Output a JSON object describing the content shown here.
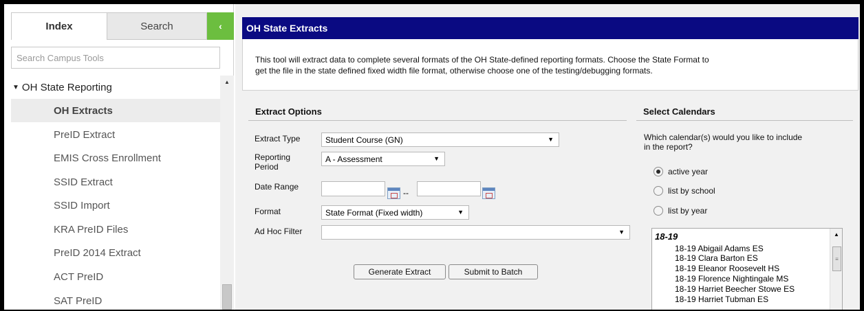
{
  "sidebar": {
    "tabs": {
      "index": "Index",
      "search": "Search"
    },
    "collapse_glyph": "‹",
    "search_placeholder": "Search Campus Tools",
    "group": {
      "label": "OH State Reporting",
      "caret": "▼"
    },
    "items": [
      {
        "label": "OH Extracts",
        "active": true
      },
      {
        "label": "PreID Extract"
      },
      {
        "label": "EMIS Cross Enrollment"
      },
      {
        "label": "SSID Extract"
      },
      {
        "label": "SSID Import"
      },
      {
        "label": "KRA PreID Files"
      },
      {
        "label": "PreID 2014 Extract"
      },
      {
        "label": "ACT PreID"
      },
      {
        "label": "SAT PreID"
      }
    ]
  },
  "main": {
    "title": "OH State Extracts",
    "description_line1": "This tool will extract data to complete several formats of the OH State-defined reporting formats. Choose the State Format to",
    "description_line2": "get the file in the state defined fixed width file format, otherwise choose one of the testing/debugging formats.",
    "extract_options": {
      "heading": "Extract Options",
      "extract_type_label": "Extract Type",
      "extract_type_value": "Student Course (GN)",
      "reporting_period_label_1": "Reporting",
      "reporting_period_label_2": "Period",
      "reporting_period_value": "A - Assessment",
      "date_range_label": "Date Range",
      "date_separator": "--",
      "format_label": "Format",
      "format_value": "State Format (Fixed width)",
      "ad_hoc_label": "Ad Hoc Filter",
      "ad_hoc_value": "",
      "generate_button": "Generate Extract",
      "batch_button": "Submit to Batch"
    },
    "calendars": {
      "heading": "Select Calendars",
      "question_1": "Which calendar(s) would you like to include",
      "question_2": "in the report?",
      "options": [
        {
          "label": "active year",
          "checked": true
        },
        {
          "label": "list by school",
          "checked": false
        },
        {
          "label": "list by year",
          "checked": false
        }
      ],
      "year": "18-19",
      "schools": [
        "18-19 Abigail Adams ES",
        "18-19 Clara Barton ES",
        "18-19 Eleanor Roosevelt HS",
        "18-19 Florence Nightingale MS",
        "18-19 Harriet Beecher Stowe ES",
        "18-19 Harriet Tubman ES"
      ]
    }
  },
  "colors": {
    "title_bar": "#0a0a82",
    "collapse_button": "#6cbe3f",
    "panel_background": "#f1f1f1"
  }
}
